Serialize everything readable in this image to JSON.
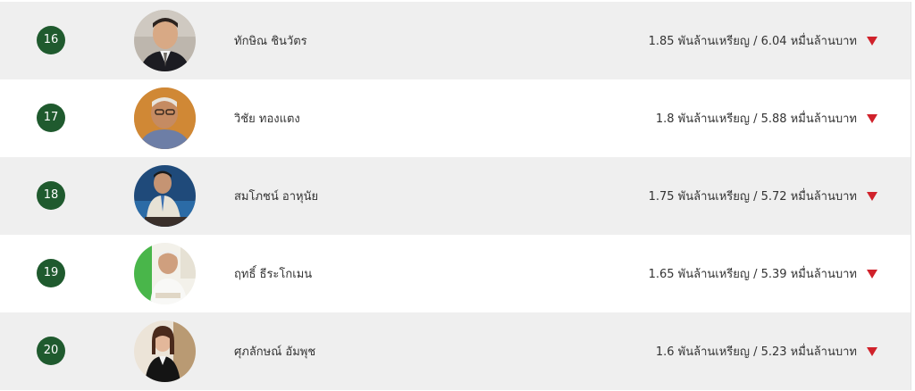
{
  "rows": [
    {
      "rank": "16",
      "name": "ทักษิณ ชินวัตร",
      "wealth": "1.85 พันล้านเหรียญ / 6.04 หมื่นล้านบาท",
      "trend": "down-arrow-icon"
    },
    {
      "rank": "17",
      "name": "วิชัย ทองแตง",
      "wealth": "1.8 พันล้านเหรียญ / 5.88 หมื่นล้านบาท",
      "trend": "down-arrow-icon"
    },
    {
      "rank": "18",
      "name": "สมโภชน์ อาหุนัย",
      "wealth": "1.75 พันล้านเหรียญ / 5.72 หมื่นล้านบาท",
      "trend": "down-arrow-icon"
    },
    {
      "rank": "19",
      "name": "ฤทธิ์ ธีระโกเมน",
      "wealth": "1.65 พันล้านเหรียญ / 5.39 หมื่นล้านบาท",
      "trend": "down-arrow-icon"
    },
    {
      "rank": "20",
      "name": "ศุภลักษณ์ อัมพุช",
      "wealth": "1.6 พันล้านเหรียญ / 5.23 หมื่นล้านบาท",
      "trend": "down-arrow-icon"
    }
  ],
  "colors": {
    "rank_badge": "#1f5a2e",
    "trend_down": "#d0222b",
    "row_shade": "#efefef",
    "row_plain": "#ffffff"
  }
}
